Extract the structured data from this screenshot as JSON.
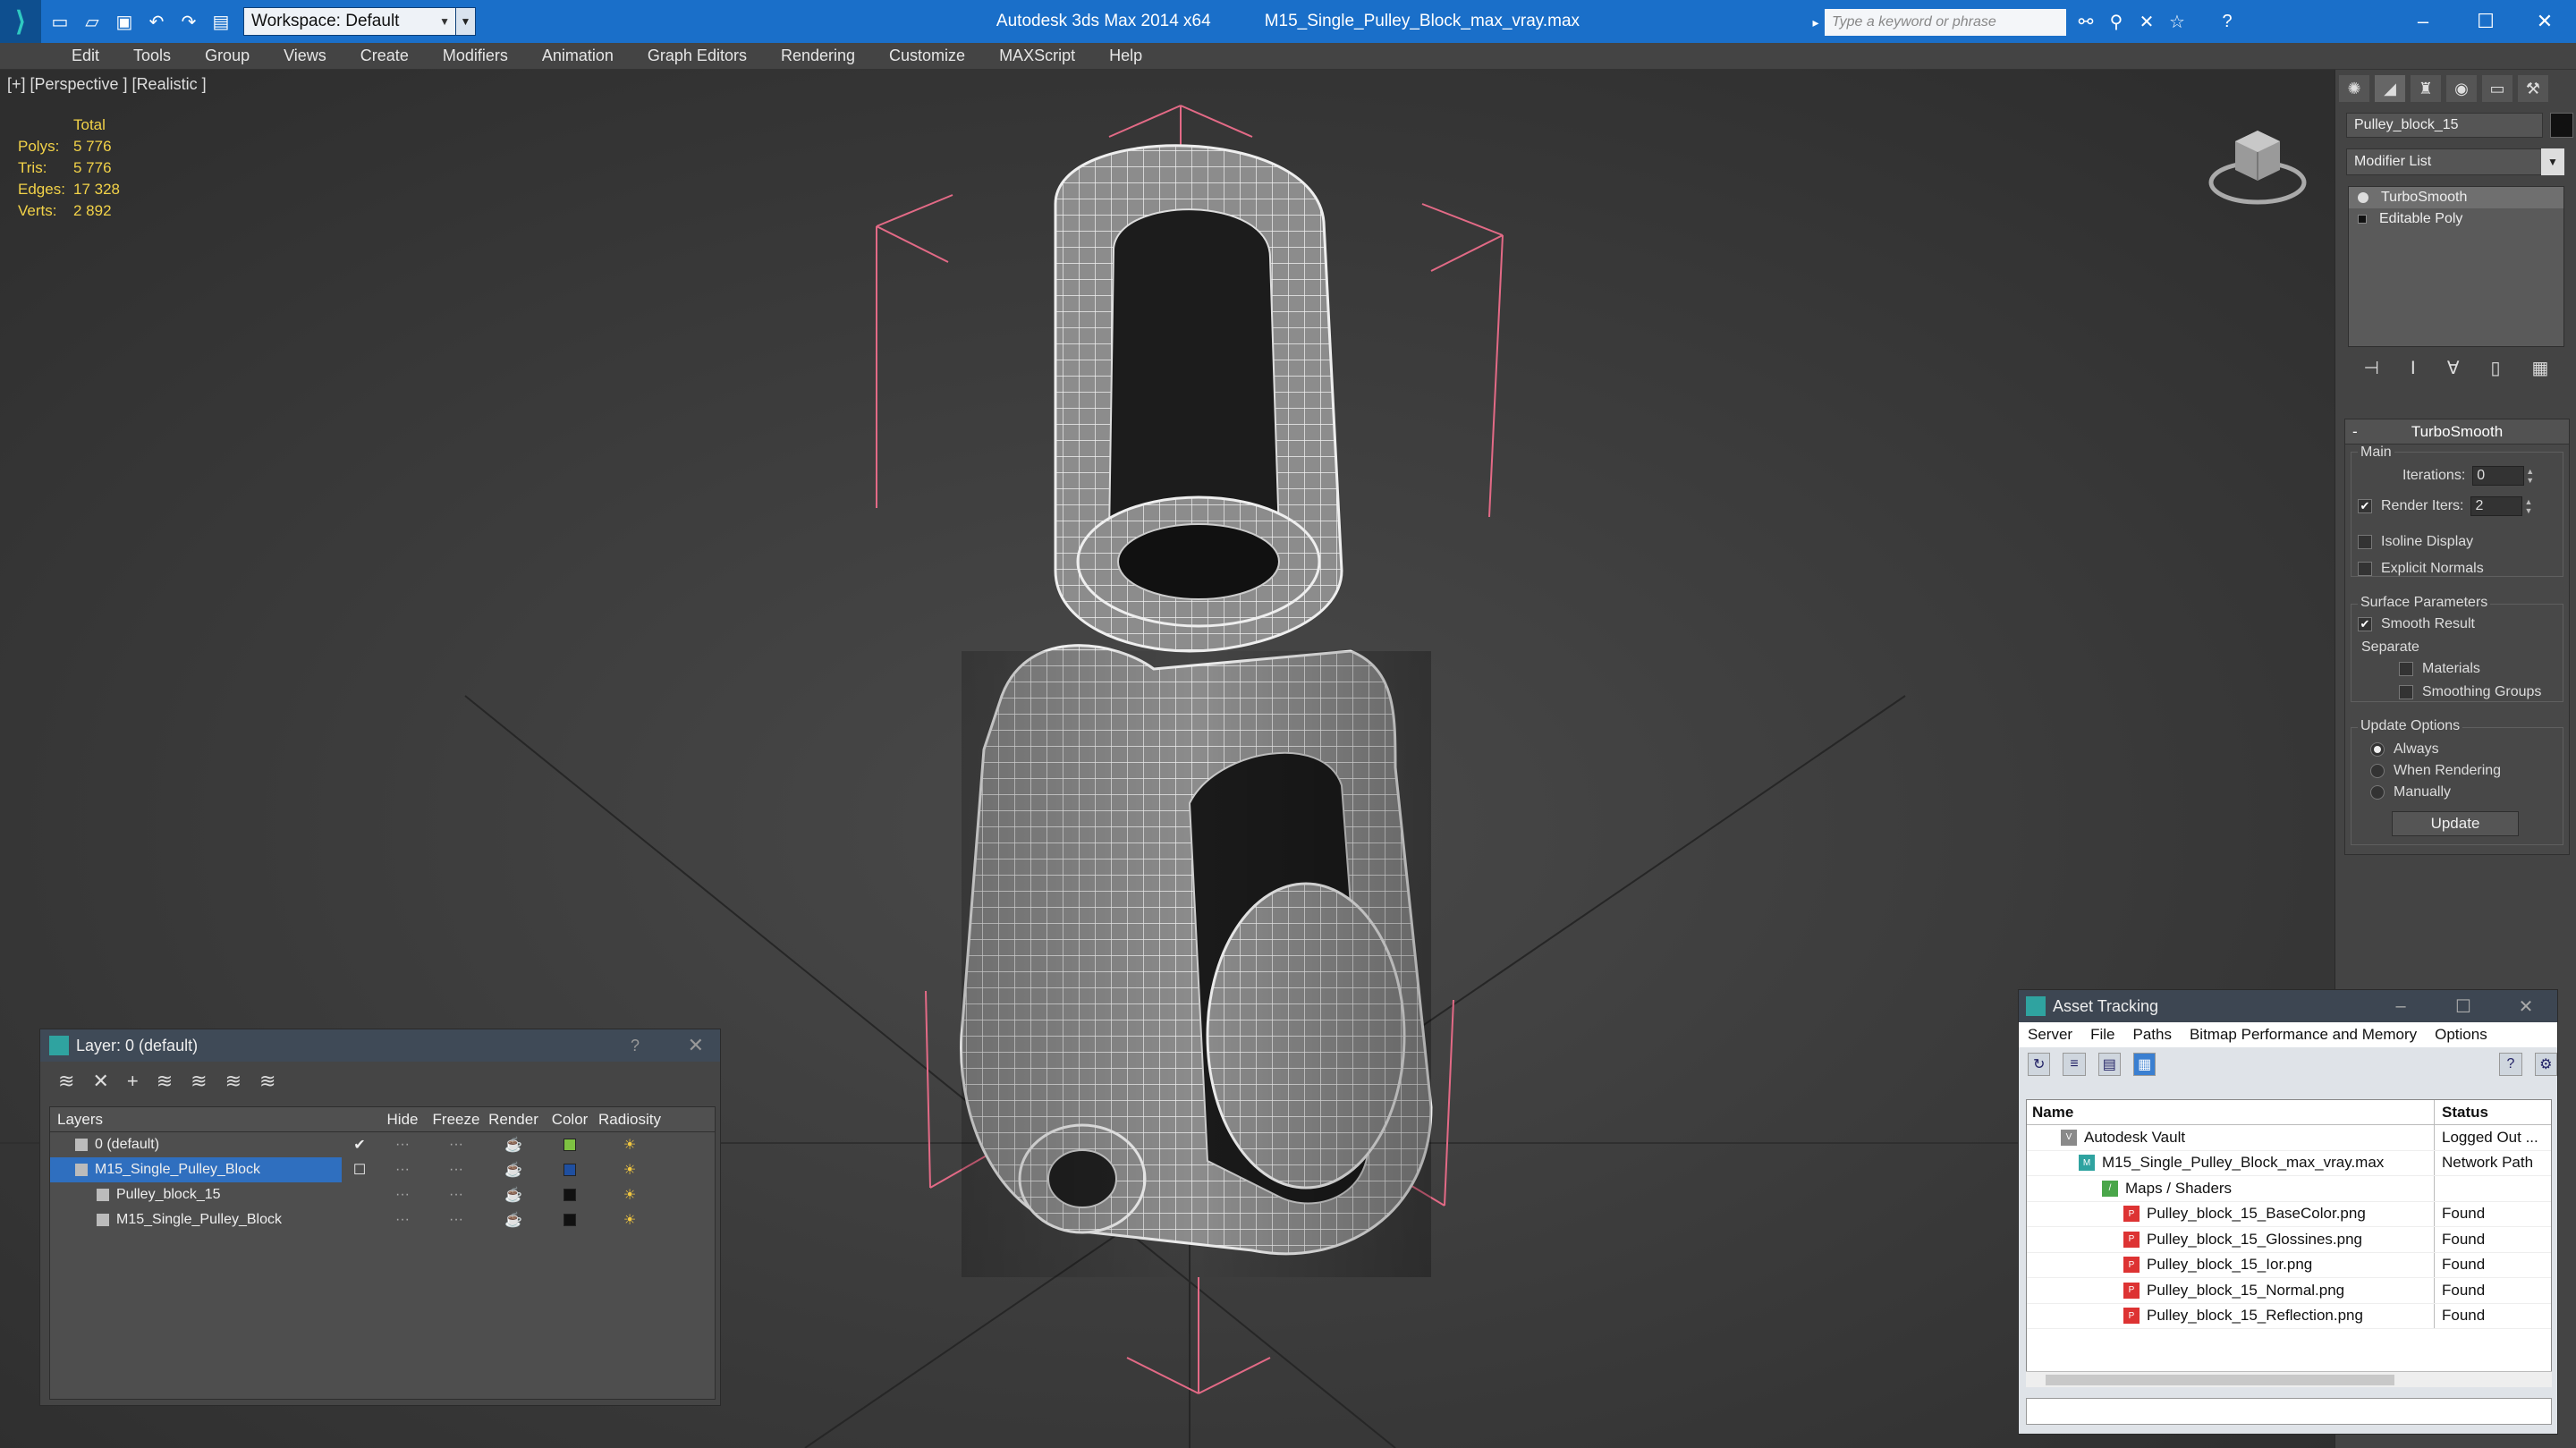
{
  "titlebar": {
    "workspace": "Workspace: Default",
    "app_name": "Autodesk 3ds Max  2014 x64",
    "file_name": "M15_Single_Pulley_Block_max_vray.max",
    "search_placeholder": "Type a keyword or phrase"
  },
  "menu": [
    "Edit",
    "Tools",
    "Group",
    "Views",
    "Create",
    "Modifiers",
    "Animation",
    "Graph Editors",
    "Rendering",
    "Customize",
    "MAXScript",
    "Help"
  ],
  "viewport": {
    "label": "[+] [Perspective ] [Realistic ]",
    "stats": {
      "header": "Total",
      "rows": [
        {
          "label": "Polys:",
          "value": "5 776"
        },
        {
          "label": "Tris:",
          "value": "5 776"
        },
        {
          "label": "Edges:",
          "value": "17 328"
        },
        {
          "label": "Verts:",
          "value": "2 892"
        }
      ]
    }
  },
  "command_panel": {
    "object_name": "Pulley_block_15",
    "modifier_list": "Modifier List",
    "stack": [
      "TurboSmooth",
      "Editable Poly"
    ],
    "rollout_title": "TurboSmooth",
    "main_label": "Main",
    "iterations_label": "Iterations:",
    "iterations_value": "0",
    "render_iters_label": "Render Iters:",
    "render_iters_value": "2",
    "isoline_label": "Isoline Display",
    "explicit_label": "Explicit Normals",
    "surface_label": "Surface Parameters",
    "smooth_label": "Smooth Result",
    "separate_label": "Separate",
    "materials_label": "Materials",
    "smoothing_label": "Smoothing Groups",
    "update_options_label": "Update Options",
    "always_label": "Always",
    "when_rendering_label": "When Rendering",
    "manually_label": "Manually",
    "update_button": "Update"
  },
  "layer_dialog": {
    "title": "Layer: 0 (default)",
    "help": "?",
    "columns": [
      "Layers",
      "Hide",
      "Freeze",
      "Render",
      "Color",
      "Radiosity"
    ],
    "rows": [
      {
        "name": "0 (default)",
        "color": "#7ec242"
      },
      {
        "name": "M15_Single_Pulley_Block",
        "color": "#1f4fa0"
      },
      {
        "name": "Pulley_block_15",
        "color": "#111111"
      },
      {
        "name": "M15_Single_Pulley_Block",
        "color": "#111111"
      }
    ]
  },
  "asset_dialog": {
    "title": "Asset Tracking",
    "menu": [
      "Server",
      "File",
      "Paths",
      "Bitmap Performance and Memory",
      "Options"
    ],
    "columns": [
      "Name",
      "Status"
    ],
    "rows": [
      {
        "name": "Autodesk Vault",
        "status": "Logged Out ..."
      },
      {
        "name": "M15_Single_Pulley_Block_max_vray.max",
        "status": "Network Path"
      },
      {
        "name": "Maps / Shaders",
        "status": ""
      },
      {
        "name": "Pulley_block_15_BaseColor.png",
        "status": "Found"
      },
      {
        "name": "Pulley_block_15_Glossines.png",
        "status": "Found"
      },
      {
        "name": "Pulley_block_15_Ior.png",
        "status": "Found"
      },
      {
        "name": "Pulley_block_15_Normal.png",
        "status": "Found"
      },
      {
        "name": "Pulley_block_15_Reflection.png",
        "status": "Found"
      }
    ]
  }
}
